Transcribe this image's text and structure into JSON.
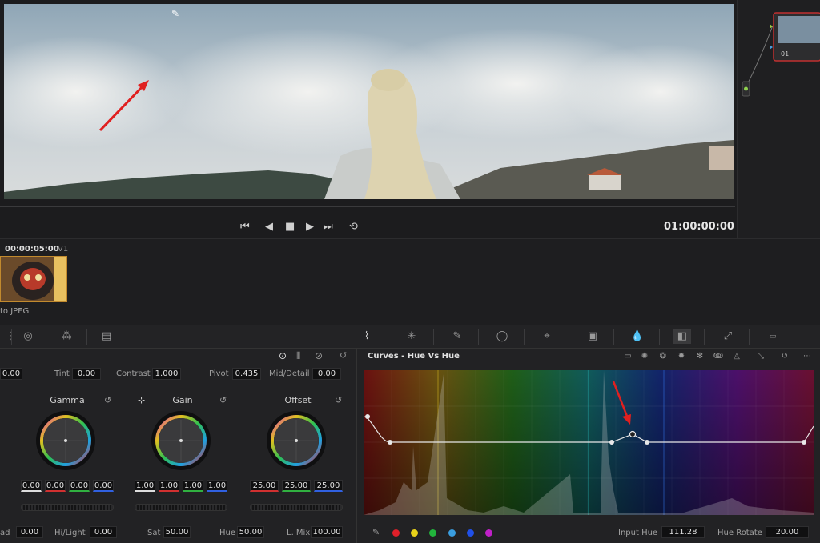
{
  "viewer": {
    "timecode": "01:00:00:00",
    "transport": [
      "⏮",
      "◀",
      "■",
      "▶",
      "⏭",
      "⟲"
    ]
  },
  "clip": {
    "timecode": "00:00:05:00",
    "track": "V1",
    "name": "to JPEG"
  },
  "primaries": {
    "top_row": {
      "lift_val": "0.00",
      "tint_label": "Tint",
      "tint": "0.00",
      "contrast_label": "Contrast",
      "contrast": "1.000",
      "pivot_label": "Pivot",
      "pivot": "0.435",
      "middetail_label": "Mid/Detail",
      "middetail": "0.00"
    },
    "wheels": [
      {
        "title": "Gamma",
        "values": [
          "0.00",
          "0.00",
          "0.00",
          "0.00"
        ]
      },
      {
        "title": "Gain",
        "values": [
          "1.00",
          "1.00",
          "1.00",
          "1.00"
        ]
      },
      {
        "title": "Offset",
        "values": [
          "25.00",
          "25.00",
          "25.00"
        ]
      }
    ],
    "bottom_row": {
      "shad_label": "ad",
      "shad": "0.00",
      "hilight_label": "Hi/Light",
      "hilight": "0.00",
      "sat_label": "Sat",
      "sat": "50.00",
      "hue_label": "Hue",
      "hue": "50.00",
      "lmix_label": "L. Mix",
      "lmix": "100.00"
    }
  },
  "curves": {
    "title": "Curves - Hue Vs Hue",
    "input_hue_label": "Input Hue",
    "input_hue": "111.28",
    "hue_rotate_label": "Hue Rotate",
    "hue_rotate": "20.00",
    "swatches": [
      "#e0202a",
      "#e8d21a",
      "#22b43c",
      "#3a9ee0",
      "#2050e8",
      "#c020c8"
    ]
  },
  "colors": {
    "accent_red": "#e02020",
    "clip_border": "#c28a2e"
  }
}
